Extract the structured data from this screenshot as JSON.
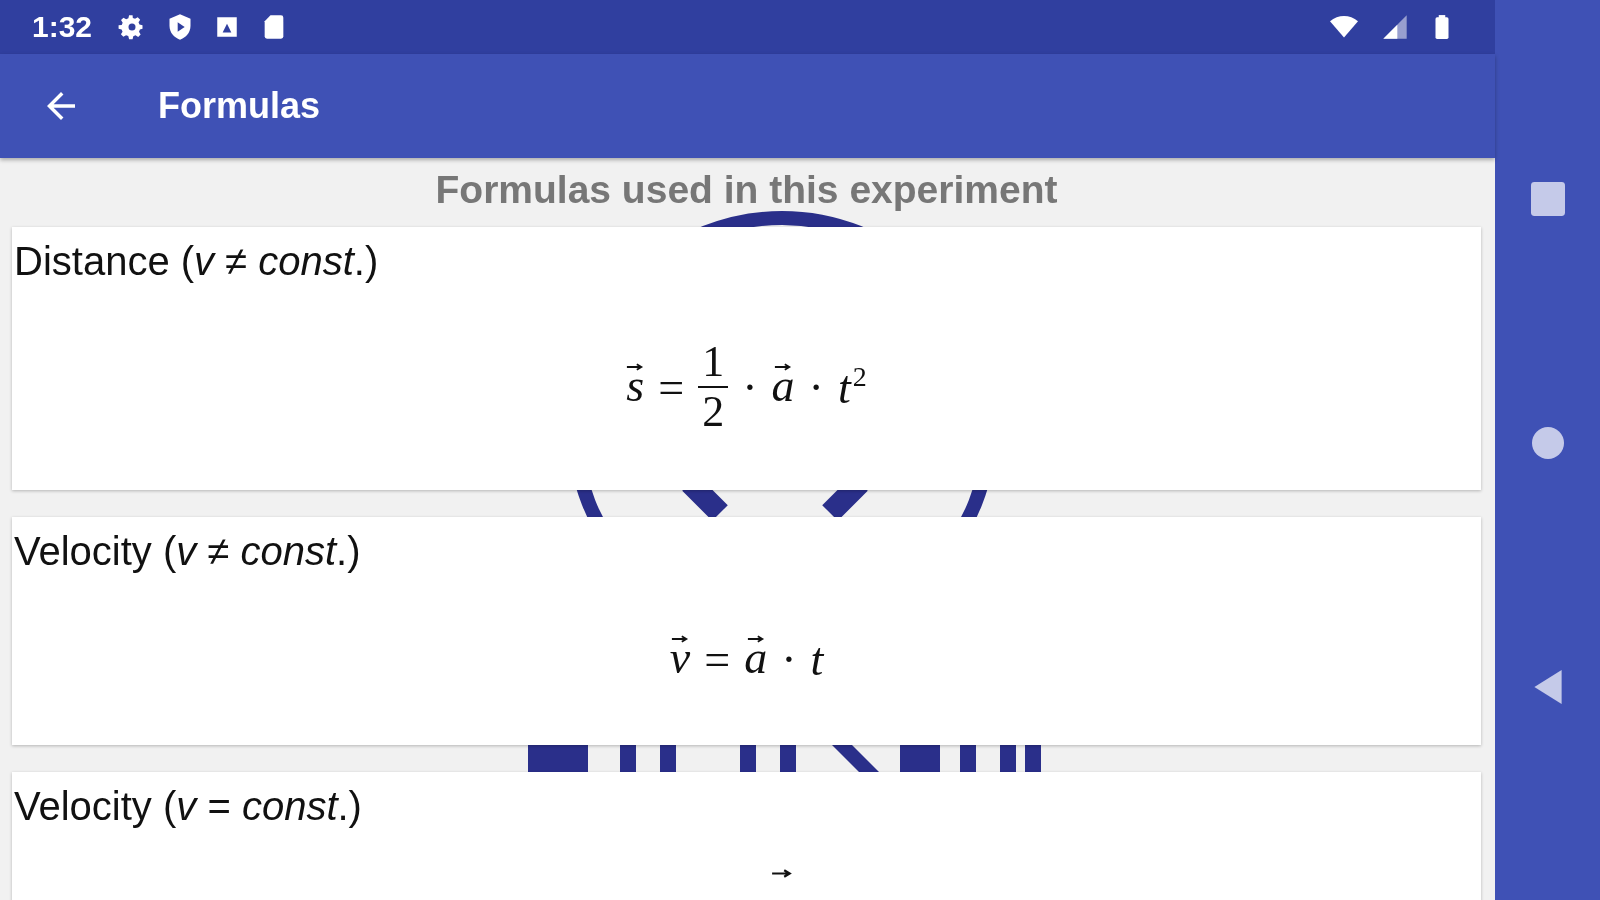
{
  "status_bar": {
    "time": "1:32"
  },
  "app_bar": {
    "title": "Formulas"
  },
  "header": "Formulas used in this experiment",
  "cards": [
    {
      "title": "Distance (*v* ≠ *const*.)",
      "formula": [
        {
          "kind": "vec",
          "text": "s"
        },
        {
          "kind": "op",
          "text": "="
        },
        {
          "kind": "frac",
          "num": "1",
          "den": "2"
        },
        {
          "kind": "op",
          "text": "·"
        },
        {
          "kind": "vec",
          "text": "a"
        },
        {
          "kind": "op",
          "text": "·"
        },
        {
          "kind": "var",
          "text": "t",
          "sup": "2"
        }
      ]
    },
    {
      "title": "Velocity (*v* ≠ *const*.)",
      "formula": [
        {
          "kind": "vec",
          "text": "v"
        },
        {
          "kind": "op",
          "text": "="
        },
        {
          "kind": "vec",
          "text": "a"
        },
        {
          "kind": "op",
          "text": "·"
        },
        {
          "kind": "var",
          "text": "t"
        }
      ]
    },
    {
      "title": "Velocity (*v* = *const*.)",
      "formula": [
        {
          "kind": "arrow"
        }
      ]
    }
  ]
}
